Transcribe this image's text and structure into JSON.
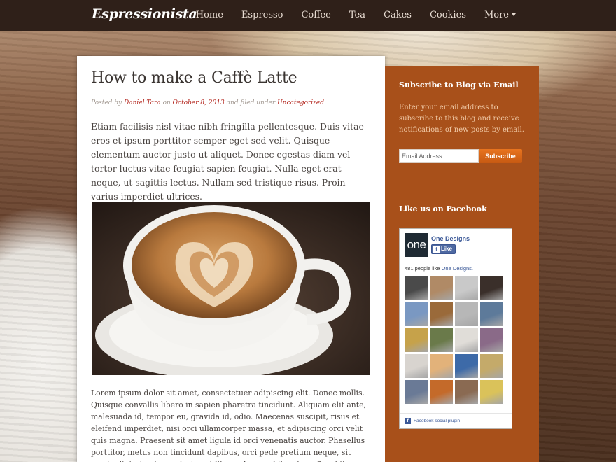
{
  "site": {
    "brand": "Espressionista"
  },
  "nav": {
    "items": [
      "Home",
      "Espresso",
      "Coffee",
      "Tea",
      "Cakes",
      "Cookies",
      "More"
    ]
  },
  "post": {
    "title": "How to make a Caffè Latte",
    "meta": {
      "posted_by": "Posted by",
      "author": "Daniel Tara",
      "on": "on",
      "date": "October 8, 2013",
      "filed_under": "and filed under",
      "category": "Uncategorized"
    },
    "lead": "Etiam facilisis nisl vitae nibh fringilla pellentesque. Duis vitae eros et ipsum porttitor semper eget sed velit. Quisque elementum auctor justo ut aliquet. Donec egestas diam vel tortor luctus vitae feugiat sapien feugiat. Nulla eget erat neque, ut sagittis lectus. Nullam sed tristique risus. Proin varius imperdiet ultrices.",
    "body": "Lorem ipsum dolor sit amet, consectetuer adipiscing elit. Donec mollis. Quisque convallis libero in sapien pharetra tincidunt. Aliquam elit ante, malesuada id, tempor eu, gravida id, odio. Maecenas suscipit, risus et eleifend imperdiet, nisi orci ullamcorper massa, et adipiscing orci velit quis magna. Praesent sit amet ligula id orci venenatis auctor. Phasellus porttitor, metus non tincidunt dapibus, orci pede pretium neque, sit amet adipiscing ipsum lectus et libero. Aenean bibendum. Curabitur mattis quam id urna."
  },
  "sidebar": {
    "subscribe": {
      "title": "Subscribe to Blog via Email",
      "text": "Enter your email address to subscribe to this blog and receive notifications of new posts by email.",
      "placeholder": "Email Address",
      "button": "Subscribe"
    },
    "facebook": {
      "title": "Like us on Facebook",
      "page_logo": "one",
      "page_name": "One Designs",
      "like_button": "Like",
      "count_text": "481 people like",
      "count_page": "One Designs.",
      "footer": "Facebook social plugin",
      "fan_colors": [
        "#4a4a4a",
        "#b08a66",
        "#c9c9c9",
        "#3a2f2a",
        "#7a98c2",
        "#9a6a3a",
        "#b7b7b7",
        "#5d7a9a",
        "#c6a24a",
        "#6a7a4a",
        "#e0ddd8",
        "#8a6a88",
        "#d8d4cf",
        "#e2b27a",
        "#3d6aa8",
        "#c4aa6a",
        "#6a7a96",
        "#c46a2a",
        "#8a6a52",
        "#dac25a"
      ]
    }
  }
}
